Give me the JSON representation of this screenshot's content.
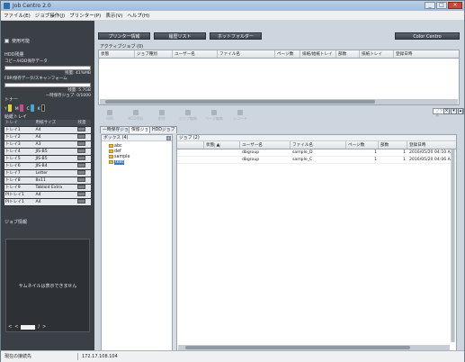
{
  "window": {
    "title": "Job Centro 2.0",
    "controls": [
      "_",
      "□",
      "×"
    ]
  },
  "menubar": {
    "items": [
      "ファイル(E)",
      "ジョブ操作(J)",
      "プリンター(P)",
      "表示(V)",
      "ヘルプ(H)"
    ]
  },
  "left": {
    "status": "使用可能",
    "hdd": {
      "title": "HDD残量",
      "copy_label": "コピー/HDD保存データ",
      "remaining1": "残量: 41%MB",
      "scan_label": "FBP/保存データ/スキャンフォーム",
      "remaining2": "残量: 5.7GB",
      "temp": "一時保存ジョブ: 0/1000"
    },
    "toner_title": "トナー",
    "toner": [
      {
        "label": "Y",
        "color": "#e6d23a"
      },
      {
        "label": "M",
        "color": "#d04a8a"
      },
      {
        "label": "C",
        "color": "#3fa6d6"
      },
      {
        "label": "K",
        "color": "#222222"
      }
    ],
    "tray_title": "給紙トレイ",
    "tray_headers": [
      "トレイ",
      "用紙サイズ",
      "残量"
    ],
    "trays": [
      {
        "name": "トレイ1",
        "size": "A4"
      },
      {
        "name": "トレイ2",
        "size": "A4"
      },
      {
        "name": "トレイ3",
        "size": "A3"
      },
      {
        "name": "トレイ4",
        "size": "JIS-B5"
      },
      {
        "name": "トレイ5",
        "size": "JIS-B5"
      },
      {
        "name": "トレイ6",
        "size": "JIS-B4"
      },
      {
        "name": "トレイ7",
        "size": "Letter"
      },
      {
        "name": "トレイ8",
        "size": "8x11"
      },
      {
        "name": "トレイ9",
        "size": "Tabloid Extra"
      },
      {
        "name": "PIトレイ1",
        "size": "A4"
      },
      {
        "name": "PIトレイ1",
        "size": "A4"
      }
    ],
    "job_info_title": "ジョブ情報",
    "thumb_message": "サムネイルは表示できません",
    "page_sep": "/"
  },
  "toolbar": {
    "printer_info": "プリンター情報",
    "history": "履歴リスト",
    "hot_folder": "ホットフォルダー",
    "color_centro": "Color Centro"
  },
  "active_jobs": {
    "title": "アクティブジョブ (0)",
    "columns": [
      "状態",
      "ジョブ種別",
      "ユーザー名",
      "ファイル名",
      "ページ数",
      "排紙/給紙トレイ",
      "部数",
      "排紙トレイ",
      "登録日時"
    ]
  },
  "job_tools": [
    "印刷",
    "HDD保存",
    "削除",
    "ジョブ編集",
    "ページ編集",
    "レコード"
  ],
  "search": {
    "placeholder": "ファイル名検索"
  },
  "tabs": [
    "一時保存ジョブ",
    "保留ジョブ",
    "HDDジョブ"
  ],
  "box_panel": {
    "title": "ボックス (4)",
    "add": "+",
    "folders": [
      "abc",
      "def",
      "sample",
      "test"
    ]
  },
  "jobs": {
    "title": "ジョブ (2)",
    "columns": [
      "",
      "状態",
      "ユーザー名",
      "ファイル名",
      "ページ数",
      "部数",
      "登録日時"
    ],
    "sort_mark": "▲",
    "rows": [
      {
        "user": "dbgroup",
        "file": "sample_D",
        "pages": "1",
        "copies": "1",
        "date": "2016/05/20 04:10 A"
      },
      {
        "user": "dbgroup",
        "file": "sample_C",
        "pages": "1",
        "copies": "1",
        "date": "2016/05/20 04:06 A"
      }
    ]
  },
  "statusbar": {
    "connection": "現在の接続先",
    "address": "172.17.108.104"
  }
}
